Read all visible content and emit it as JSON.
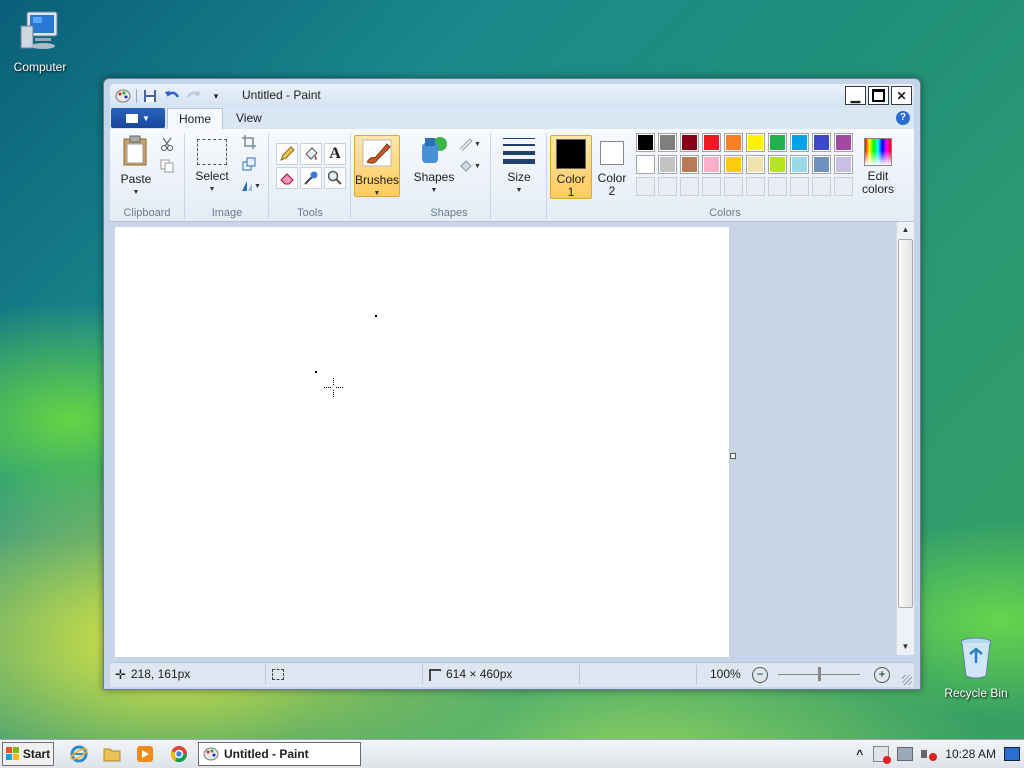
{
  "desktop": {
    "computer_label": "Computer",
    "recycle_label": "Recycle Bin"
  },
  "window": {
    "title": "Untitled - Paint",
    "tabs": [
      "Home",
      "View"
    ],
    "help": "?"
  },
  "ribbon": {
    "clipboard": {
      "paste": "Paste",
      "group": "Clipboard"
    },
    "image": {
      "select": "Select",
      "group": "Image"
    },
    "tools": {
      "group": "Tools",
      "text_tool": "A"
    },
    "brushes": "Brushes",
    "shapes": {
      "label": "Shapes",
      "group": "Shapes"
    },
    "size": "Size",
    "colors": {
      "color1_l1": "Color",
      "color1_l2": "1",
      "color2_l1": "Color",
      "color2_l2": "2",
      "edit_l1": "Edit",
      "edit_l2": "colors",
      "group": "Colors",
      "color1_value": "#000000",
      "color2_value": "#ffffff",
      "row1": [
        "#000000",
        "#7f7f7f",
        "#880015",
        "#ed1c24",
        "#ff7f27",
        "#fff200",
        "#22b14c",
        "#00a2e8",
        "#3f48cc",
        "#a349a4"
      ],
      "row2": [
        "#ffffff",
        "#c3c3c3",
        "#b97a57",
        "#ffaec9",
        "#ffc90e",
        "#efe4b0",
        "#b5e61d",
        "#99d9ea",
        "#7092be",
        "#c8bfe7"
      ]
    }
  },
  "status": {
    "cursor_pos": "218, 161px",
    "canvas_size": "614 × 460px",
    "zoom": "100%"
  },
  "taskbar": {
    "start": "Start",
    "task": "Untitled - Paint",
    "clock": "10:28 AM"
  }
}
